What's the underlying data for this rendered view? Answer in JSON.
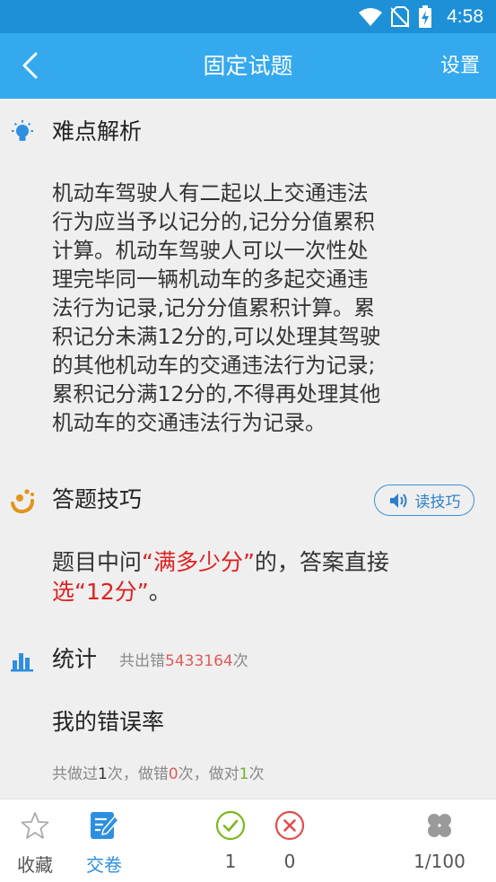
{
  "status_bar": {
    "time": "4:58"
  },
  "app_bar": {
    "title": "固定试题",
    "settings_label": "设置"
  },
  "analysis": {
    "heading": "难点解析",
    "lines": [
      "机动车驾驶人有二起以上交通违法",
      "行为应当予以记分的,记分分值累积",
      "计算。机动车驾驶人可以一次性处",
      "理完毕同一辆机动车的多起交通违",
      "法行为记录,记分分值累积计算。累",
      "积记分未满12分的,可以处理其驾驶",
      "的其他机动车的交通违法行为记录;",
      "累积记分满12分的,不得再处理其他",
      "机动车的交通违法行为记录。"
    ]
  },
  "tips": {
    "heading": "答题技巧",
    "read_button": "读技巧",
    "line1_prefix": "题目中问",
    "line1_highlight": "“满多少分”",
    "line1_suffix": "的，答案直接",
    "line2_highlight": "选“12分”",
    "line2_suffix": "。"
  },
  "stats": {
    "heading": "统计",
    "total_prefix": "共出错",
    "total_count": "5433164",
    "total_suffix": "次",
    "my_rate_label": "我的错误率",
    "done_prefix": "共做过",
    "done_count": "1",
    "wrong_prefix": "次，做错",
    "wrong_count": "0",
    "right_prefix": "次，做对",
    "right_count": "1",
    "right_suffix": "次"
  },
  "bottom_bar": {
    "favorite_label": "收藏",
    "submit_label": "交卷",
    "correct_count": "1",
    "wrong_count": "0",
    "progress": "1/100"
  },
  "colors": {
    "status_bar": "#1e90d8",
    "app_bar": "#34a9ee",
    "accent_blue": "#2e8fe0",
    "highlight_red": "#e02020",
    "correct_green": "#7cb71f",
    "wrong_red": "#e24c4c"
  }
}
